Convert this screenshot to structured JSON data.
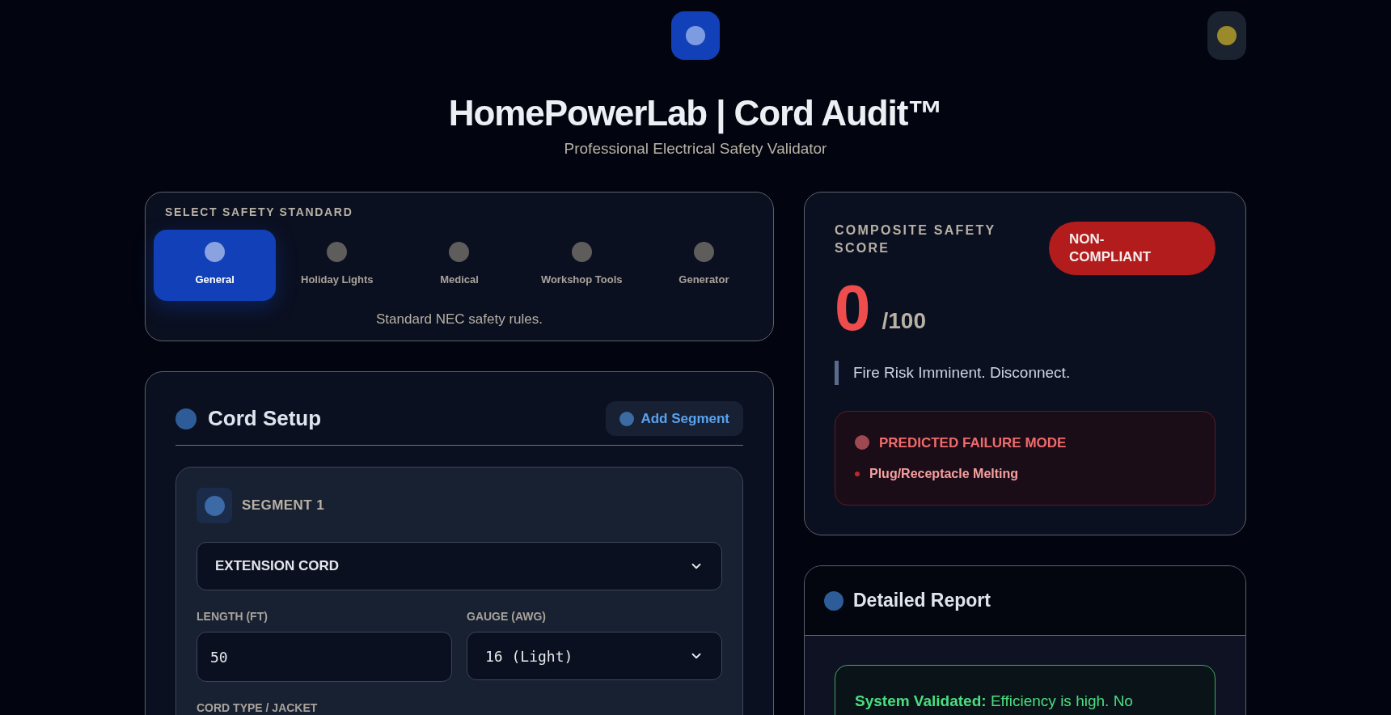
{
  "header": {
    "title": "HomePowerLab | Cord Audit™",
    "subtitle": "Professional Electrical Safety Validator"
  },
  "standard_selector": {
    "heading": "SELECT SAFETY STANDARD",
    "options": [
      {
        "label": "General",
        "selected": true
      },
      {
        "label": "Holiday Lights",
        "selected": false
      },
      {
        "label": "Medical",
        "selected": false
      },
      {
        "label": "Workshop Tools",
        "selected": false
      },
      {
        "label": "Generator",
        "selected": false
      }
    ],
    "description": "Standard NEC safety rules."
  },
  "cord_setup": {
    "title": "Cord Setup",
    "add_button": "Add Segment",
    "segments": [
      {
        "title": "SEGMENT 1",
        "device_type": "EXTENSION CORD",
        "length_label": "LENGTH (FT)",
        "length_value": "50",
        "gauge_label": "GAUGE (AWG)",
        "gauge_value": "16 (Light)",
        "cord_type_label": "CORD TYPE / JACKET"
      }
    ]
  },
  "score": {
    "heading": "COMPOSITE SAFETY SCORE",
    "status": "NON-COMPLIANT",
    "value": "0",
    "max": "/100",
    "message": "Fire Risk Imminent. Disconnect.",
    "failure": {
      "heading": "PREDICTED FAILURE MODE",
      "items": [
        "Plug/Receptacle Melting"
      ]
    }
  },
  "report": {
    "title": "Detailed Report",
    "notice": "**System Validated:** Efficiency is high. No"
  }
}
